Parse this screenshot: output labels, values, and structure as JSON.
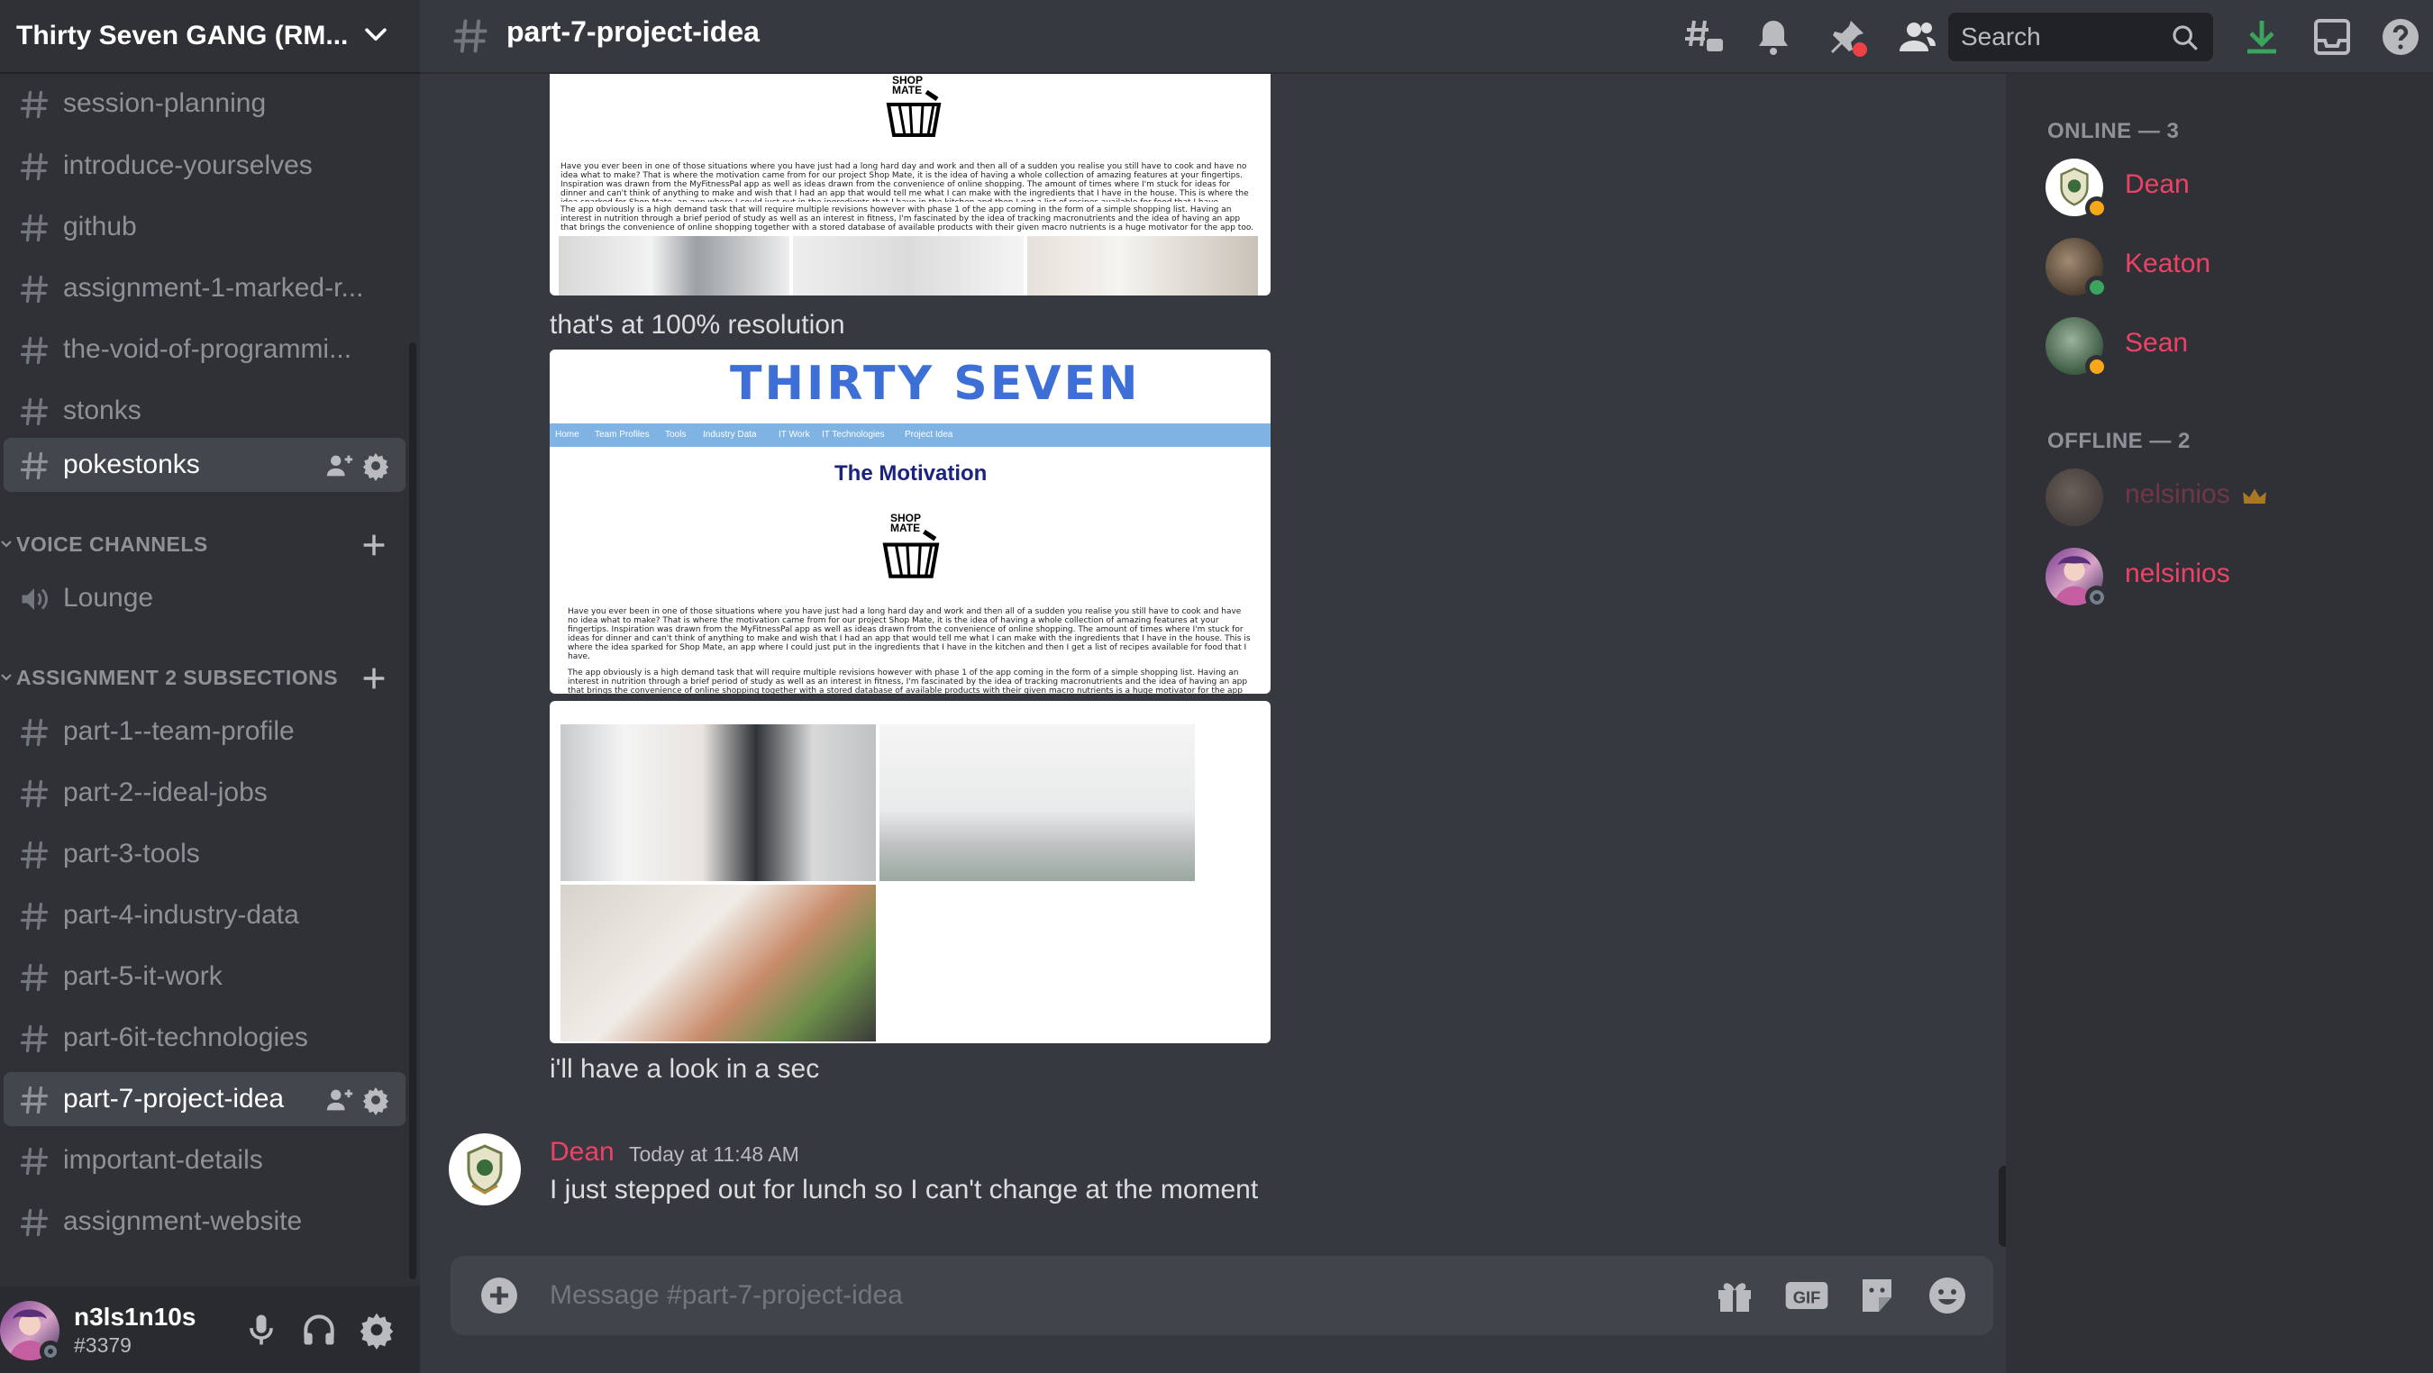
{
  "server": {
    "name": "Thirty Seven GANG (RM..."
  },
  "channels_top": [
    {
      "label": "session-planning"
    },
    {
      "label": "introduce-yourselves"
    },
    {
      "label": "github"
    },
    {
      "label": "assignment-1-marked-r..."
    },
    {
      "label": "the-void-of-programmi..."
    },
    {
      "label": "stonks"
    },
    {
      "label": "pokestonks"
    }
  ],
  "voice_category": {
    "label": "VOICE CHANNELS"
  },
  "voice_channels": [
    {
      "label": "Lounge"
    }
  ],
  "assignment_category": {
    "label": "ASSIGNMENT 2 SUBSECTIONS"
  },
  "assignment_channels": [
    {
      "label": "part-1--team-profile"
    },
    {
      "label": "part-2--ideal-jobs"
    },
    {
      "label": "part-3-tools"
    },
    {
      "label": "part-4-industry-data"
    },
    {
      "label": "part-5-it-work"
    },
    {
      "label": "part-6it-technologies"
    },
    {
      "label": "part-7-project-idea"
    },
    {
      "label": "important-details"
    },
    {
      "label": "assignment-website"
    }
  ],
  "user": {
    "name": "n3ls1n10s",
    "tag": "#3379",
    "status": "offline"
  },
  "topbar": {
    "channel": "part-7-project-idea",
    "search_placeholder": "Search"
  },
  "messages": [
    {
      "text": "that's at 100% resolution"
    },
    {
      "text": "i'll have a look in a sec"
    },
    {
      "author": "Dean",
      "timestamp": "Today at 11:48 AM",
      "text": "I just stepped out for lunch so I can't change at the moment"
    }
  ],
  "attachment": {
    "site_title": "THIRTY SEVEN",
    "nav": [
      "Home",
      "Team Profiles",
      "Tools",
      "Industry Data",
      "IT Work",
      "IT Technologies",
      "Project Idea"
    ],
    "heading": "The Motivation",
    "logo_text": [
      "SHOP",
      "MATE"
    ],
    "paragraph_1": "Have you ever been in one of those situations where you have just had a long hard day and work and then all of a sudden you realise you still have to cook and have no idea what to make? That is where the motivation came from for our project Shop Mate, it is the idea of having a whole collection of amazing features at your fingertips. Inspiration was drawn from the MyFitnessPal app as well as ideas drawn from the convenience of online shopping. The amount of times where I'm stuck for ideas for dinner and can't think of anything to make and wish that I had an app that would tell me what I can make with the ingredients that I have in the house. This is where the idea sparked for Shop Mate, an app where I could just put in the ingredients that I have in the kitchen and then I get a list of recipes available for food that I have.",
    "paragraph_2": "The app obviously is a high demand task that will require multiple revisions however with phase 1 of the app coming in the form of a simple shopping list. Having an interest in nutrition through a brief period of study as well as an interest in fitness, I'm fascinated by the idea of tracking macronutrients and the idea of having an app that brings the convenience of online shopping together with a stored database of available products with their given macro nutrients is a huge motivator for the app too."
  },
  "composer": {
    "placeholder": "Message #part-7-project-idea"
  },
  "members": {
    "online_header": "ONLINE — 3",
    "offline_header": "OFFLINE — 2",
    "online": [
      {
        "name": "Dean",
        "status": "idle"
      },
      {
        "name": "Keaton",
        "status": "online"
      },
      {
        "name": "Sean",
        "status": "idle"
      }
    ],
    "offline": [
      {
        "name": "nelsinios",
        "badge": "crown-icon"
      },
      {
        "name": "nelsinios",
        "status": "offline"
      }
    ]
  },
  "colors": {
    "accent_name": "#ed4266",
    "online": "#3ba55d",
    "idle": "#faa81a",
    "download": "#3ba55d",
    "site_nav": "#7fb3e3",
    "site_heading": "#1a237e"
  }
}
